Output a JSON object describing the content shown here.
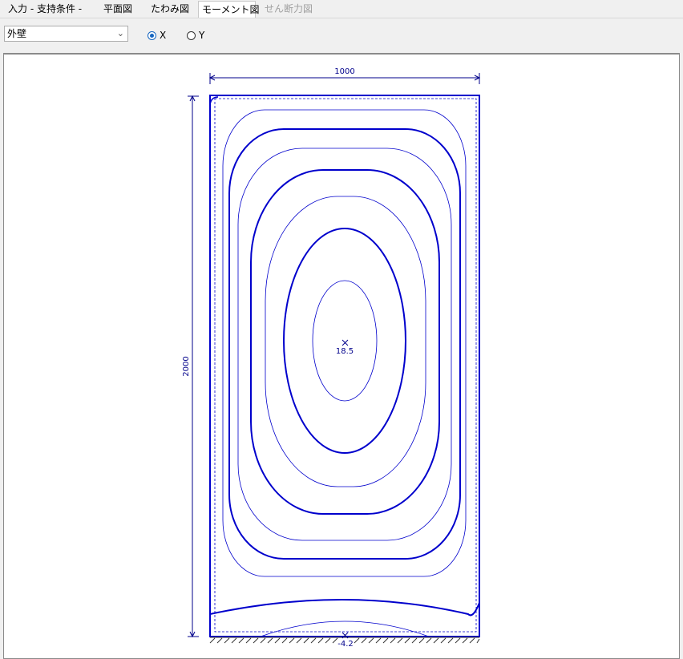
{
  "tabs": [
    {
      "label": "入力 - 支持条件 -",
      "state": "normal"
    },
    {
      "label": "平面図",
      "state": "normal"
    },
    {
      "label": "たわみ図",
      "state": "normal"
    },
    {
      "label": "モーメント図",
      "state": "active"
    },
    {
      "label": "せん断力図",
      "state": "disabled"
    }
  ],
  "options": {
    "wall_select": {
      "value": "外壁"
    },
    "radio_x": {
      "label": "X",
      "checked": true
    },
    "radio_y": {
      "label": "Y",
      "checked": false
    }
  },
  "diagram": {
    "width_label": "1000",
    "height_label": "2000",
    "max_value_label": "18.5",
    "min_value_label": "-4.2",
    "line_color": "#0000cc",
    "dim_color": "#00008b"
  }
}
